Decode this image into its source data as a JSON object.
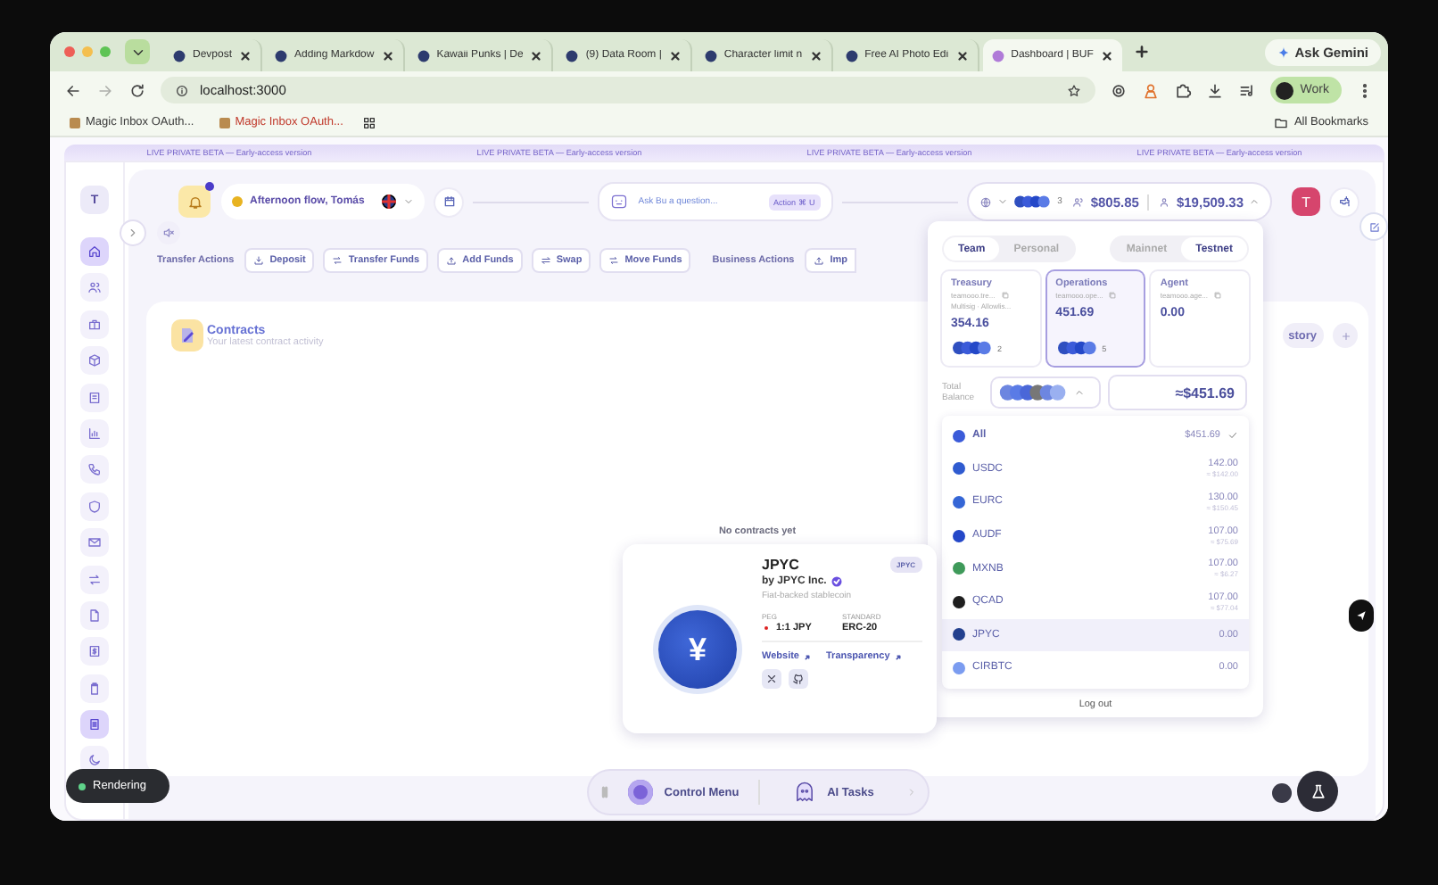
{
  "browser": {
    "tabs": [
      {
        "title": "Devpost",
        "selected": false
      },
      {
        "title": "Adding Markdow",
        "selected": false
      },
      {
        "title": "Kawaii Punks | De",
        "selected": false
      },
      {
        "title": "(9) Data Room | ",
        "selected": false
      },
      {
        "title": "Character limit n",
        "selected": false
      },
      {
        "title": "Free AI Photo Edi",
        "selected": false
      },
      {
        "title": "Dashboard | BUF",
        "selected": true
      }
    ],
    "ask_button": "Ask Gemini",
    "url": "localhost:3000",
    "profile": "Work",
    "bookmarks": [
      {
        "label": "Magic Inbox OAuth...",
        "color": "#3a3a3a"
      },
      {
        "label": "Magic Inbox OAuth...",
        "color": "#c0392b"
      }
    ],
    "all_bookmarks": "All Bookmarks"
  },
  "banner": [
    "LIVE PRIVATE BETA — Early-access version",
    "LIVE PRIVATE BETA — Early-access version",
    "LIVE PRIVATE BETA — Early-access version",
    "LIVE PRIVATE BETA — Early-access version"
  ],
  "sidebar": {
    "avatar": "T",
    "items": [
      {
        "selected": true
      },
      {
        "selected": false
      },
      {
        "selected": false
      },
      {
        "selected": false
      },
      {
        "selected": false
      },
      {
        "selected": false
      },
      {
        "selected": false
      },
      {
        "selected": false
      },
      {
        "selected": false
      },
      {
        "selected": false
      },
      {
        "selected": false
      },
      {
        "selected": false
      },
      {
        "selected": false
      },
      {
        "selected": true
      },
      {
        "selected": false
      }
    ]
  },
  "header": {
    "unread": true,
    "greeting": "Afternoon flow, Tomás",
    "ask": "Ask Bu a question...",
    "shortcut": "Action ⌘ U",
    "token_count": "3",
    "team_balance": "$805.85",
    "personal_balance": "$19,509.33",
    "avatar": "T"
  },
  "actions": {
    "transfer_label": "Transfer Actions",
    "transfer": [
      "Deposit",
      "Transfer Funds",
      "Add Funds",
      "Swap",
      "Move Funds"
    ],
    "business_label": "Business Actions",
    "business": [
      "Imp"
    ]
  },
  "contracts": {
    "title": "Contracts",
    "subtitle": "Your latest contract activity",
    "empty": "No contracts yet",
    "history_button": "story"
  },
  "wallet_menu": {
    "scopes": [
      {
        "label": "Team",
        "selected": true
      },
      {
        "label": "Personal",
        "selected": false
      }
    ],
    "networks": [
      {
        "label": "Mainnet",
        "selected": false
      },
      {
        "label": "Testnet",
        "selected": true
      }
    ],
    "accounts": [
      {
        "name": "Treasury",
        "address": "teamooo.tre...",
        "note": "Multisig · Allowlis...",
        "balance": "354.16",
        "token_count": "2",
        "selected": false
      },
      {
        "name": "Operations",
        "address": "teamooo.ope...",
        "balance": "451.69",
        "token_count": "5",
        "selected": true
      },
      {
        "name": "Agent",
        "address": "teamooo.age...",
        "balance": "0.00",
        "selected": false
      }
    ],
    "total_label": "Total Balance",
    "total": "≈$451.69",
    "tokens": [
      {
        "symbol": "All",
        "amount": "$451.69",
        "selected": true,
        "highlighted": false,
        "color": "#3b5bd9"
      },
      {
        "symbol": "USDC",
        "amount": "142.00",
        "fiat": "≈ $142.00",
        "selected": false,
        "highlighted": false,
        "color": "#2f5bd0"
      },
      {
        "symbol": "EURC",
        "amount": "130.00",
        "fiat": "≈ $150.45",
        "selected": false,
        "highlighted": false,
        "color": "#3566d6"
      },
      {
        "symbol": "AUDF",
        "amount": "107.00",
        "fiat": "≈ $75.69",
        "selected": false,
        "highlighted": false,
        "color": "#2448c8"
      },
      {
        "symbol": "MXNB",
        "amount": "107.00",
        "fiat": "≈ $6.27",
        "selected": false,
        "highlighted": false,
        "color": "#3f9a5a"
      },
      {
        "symbol": "QCAD",
        "amount": "107.00",
        "fiat": "≈ $77.04",
        "selected": false,
        "highlighted": false,
        "color": "#1e1e1e"
      },
      {
        "symbol": "JPYC",
        "amount": "0.00",
        "selected": false,
        "highlighted": true,
        "color": "#23408e"
      },
      {
        "symbol": "CIRBTC",
        "amount": "0.00",
        "selected": false,
        "highlighted": false,
        "color": "#7b9cf0"
      }
    ],
    "logout": "Log out"
  },
  "token_card": {
    "title": "JPYC",
    "badge": "JPYC",
    "issuer": "by JPYC Inc.",
    "verified": true,
    "description": "Fiat-backed stablecoin",
    "symbol": "¥",
    "peg_label": "PEG",
    "peg": "1:1 JPY",
    "standard_label": "STANDARD",
    "standard": "ERC-20",
    "links": [
      "Website",
      "Transparency"
    ]
  },
  "dock": {
    "control_menu": "Control Menu",
    "ai_tasks": "AI Tasks"
  },
  "toast": {
    "label": "Rendering"
  }
}
